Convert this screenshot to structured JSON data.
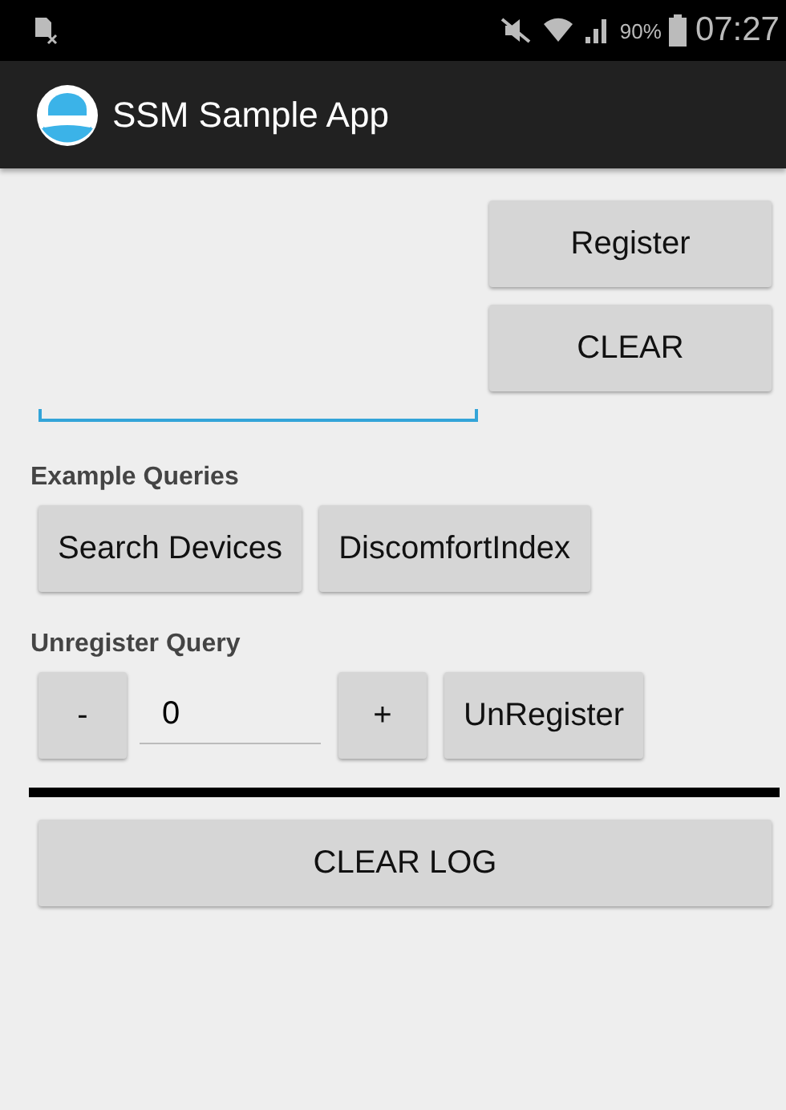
{
  "status_bar": {
    "battery": "90%",
    "time": "07:27"
  },
  "app_bar": {
    "title": "SSM Sample App"
  },
  "query_field": {
    "focused": true
  },
  "query_buttons": [
    "Register",
    "CLEAR"
  ],
  "example_queries": {
    "heading": "Example Queries",
    "buttons": [
      "Search Devices",
      "DiscomfortIndex"
    ]
  },
  "unregister_query": {
    "heading": "Unregister Query",
    "minus": "-",
    "value": "0",
    "plus": "+",
    "button": "UnRegister"
  },
  "clear_log_button": "CLEAR LOG"
}
